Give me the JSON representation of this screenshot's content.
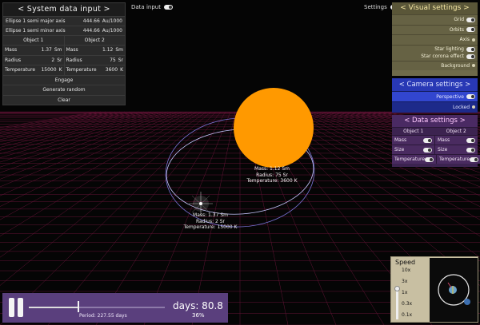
{
  "colors": {
    "sun": "#ff9900",
    "visual_panel": "#6e6a4a",
    "camera_panel": "#1d2a8a",
    "data_panel": "#3c2350",
    "timeline": "#5a3f7d",
    "grid": "#8a1a4a"
  },
  "topbar": {
    "data_input_label": "Data input",
    "settings_label": "Settings"
  },
  "system_panel": {
    "title": "< System data input >",
    "semi_major_label": "Ellipse 1 semi major axis",
    "semi_major_value": "444.66",
    "semi_major_unit": "Au/1000",
    "semi_minor_label": "Ellipse 1 semi minor axis",
    "semi_minor_value": "444.66",
    "semi_minor_unit": "Au/1000",
    "objects": [
      {
        "header": "Object 1",
        "mass_label": "Mass",
        "mass_value": "1.37",
        "mass_unit": "Sm",
        "radius_label": "Radius",
        "radius_value": "2",
        "radius_unit": "Sr",
        "temp_label": "Temperature",
        "temp_value": "15000",
        "temp_unit": "K"
      },
      {
        "header": "Object 2",
        "mass_label": "Mass",
        "mass_value": "1.12",
        "mass_unit": "Sm",
        "radius_label": "Radius",
        "radius_value": "75",
        "radius_unit": "Sr",
        "temp_label": "Temperature",
        "temp_value": "3600",
        "temp_unit": "K"
      }
    ],
    "engage_label": "Engage",
    "generate_label": "Generate random",
    "clear_label": "Clear"
  },
  "visual_settings": {
    "title": "< Visual settings >",
    "grid_label": "Grid",
    "orbits_label": "Orbits",
    "axis_label": "Axis",
    "star_lighting_label": "Star lighting",
    "star_corona_label": "Star corona effect",
    "background_label": "Background"
  },
  "camera_settings": {
    "title": "< Camera settings >",
    "perspective_label": "Perspective",
    "locked_label": "Locked"
  },
  "data_settings": {
    "title": "< Data settings >",
    "object1_header": "Object 1",
    "object2_header": "Object 2",
    "mass_label": "Mass",
    "size_label": "Size",
    "temperature_label": "Temperature"
  },
  "scene": {
    "object2_label": [
      "Mass: 1.12 Sm",
      "Radius: 75 Sr",
      "Temperature: 3600 K"
    ],
    "object1_label": [
      "Mass: 1.37 Sm",
      "Radius: 2 Sr",
      "Temperature: 15000 K"
    ]
  },
  "speed": {
    "title": "Speed",
    "ticks": [
      "10x",
      "3x",
      "1x",
      "0.3x",
      "0.1x"
    ]
  },
  "timeline": {
    "period_text": "Period: 227.55 days",
    "days_text": "days: 80.8",
    "percent_text": "36%",
    "progress": 0.36
  }
}
